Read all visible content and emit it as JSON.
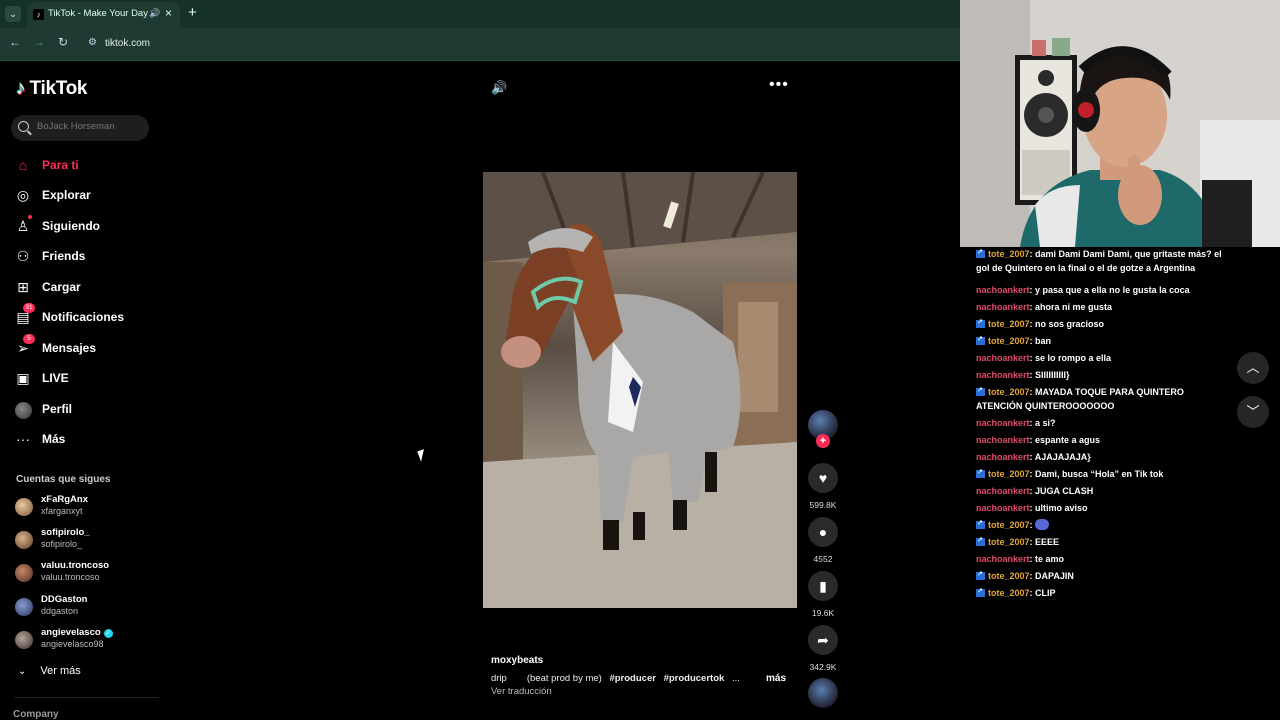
{
  "browser": {
    "tab_title": "TikTok - Make Your Day",
    "url": "tiktok.com"
  },
  "sidebar": {
    "logo_text": "TikTok",
    "search_placeholder": "BoJack Horseman",
    "menu": [
      {
        "label": "Para ti",
        "icon": "home-icon",
        "active": true
      },
      {
        "label": "Explorar",
        "icon": "compass-icon"
      },
      {
        "label": "Siguiendo",
        "icon": "following-icon"
      },
      {
        "label": "Friends",
        "icon": "friends-icon"
      },
      {
        "label": "Cargar",
        "icon": "upload-icon"
      },
      {
        "label": "Notificaciones",
        "icon": "inbox-icon",
        "badge": "31"
      },
      {
        "label": "Mensajes",
        "icon": "send-icon",
        "badge": "5"
      },
      {
        "label": "LIVE",
        "icon": "live-icon"
      },
      {
        "label": "Perfil",
        "icon": "avatar"
      },
      {
        "label": "Más",
        "icon": "more-icon"
      }
    ],
    "following_title": "Cuentas que sigues",
    "accounts": [
      {
        "name": "xFaRgAnx",
        "handle": "xfarganxyt"
      },
      {
        "name": "sofipirolo_",
        "handle": "sofipirolo_"
      },
      {
        "name": "valuu.troncoso",
        "handle": "valuu.troncoso"
      },
      {
        "name": "DDGaston",
        "handle": "ddgaston"
      },
      {
        "name": "angievelasco",
        "handle": "angievelasco98",
        "verified": true
      }
    ],
    "see_more": "Ver más",
    "company": "Company"
  },
  "video": {
    "author": "moxybeats",
    "desc_start": "drip",
    "desc_paren": "(beat prod by me)",
    "tags": [
      "#producer",
      "#producertok"
    ],
    "ellipsis": "...",
    "more": "más",
    "translate": "Ver traducción",
    "likes": "599.8K",
    "comments": "4552",
    "saves": "19.6K",
    "shares": "342.9K"
  },
  "colors": {
    "accent": "#fe2c55",
    "chat_user_tote": "#e0a73a",
    "chat_user_nacho": "#e04a6a",
    "chrome_bg": "#1f3a33"
  },
  "chat": [
    {
      "user": "tote_2007",
      "type": "tote",
      "text": ": dami Dami Dami Dami, que gritaste más? el gol de Quintero en la final o el de gotze a Argentina"
    },
    {
      "user": "nachoankert",
      "type": "nacho",
      "text": ": y pasa que a ella no le gusta la coca"
    },
    {
      "user": "nachoankert",
      "type": "nacho",
      "text": ": ahora ni me gusta"
    },
    {
      "user": "tote_2007",
      "type": "tote",
      "text": ": no sos gracioso"
    },
    {
      "user": "tote_2007",
      "type": "tote",
      "text": ": ban"
    },
    {
      "user": "nachoankert",
      "type": "nacho",
      "text": ": se lo rompo a ella"
    },
    {
      "user": "nachoankert",
      "type": "nacho",
      "text": ": SIIIIIIIIII}"
    },
    {
      "user": "tote_2007",
      "type": "tote",
      "text": ": MAYADA TOQUE PARA QUINTERO ATENCIÓN QUINTEROOOOOOO"
    },
    {
      "user": "nachoankert",
      "type": "nacho",
      "text": ": a si?"
    },
    {
      "user": "nachoankert",
      "type": "nacho",
      "text": ": espante a agus"
    },
    {
      "user": "nachoankert",
      "type": "nacho",
      "text": ": AJAJAJAJA}"
    },
    {
      "user": "tote_2007",
      "type": "tote",
      "text": ": Dami, busca “Hola” en Tik tok"
    },
    {
      "user": "nachoankert",
      "type": "nacho",
      "text": ": JUGA CLASH"
    },
    {
      "user": "nachoankert",
      "type": "nacho",
      "text": ": ultimo aviso"
    },
    {
      "user": "tote_2007",
      "type": "tote",
      "text": ": ",
      "emote": true
    },
    {
      "user": "tote_2007",
      "type": "tote",
      "text": ": EEEE"
    },
    {
      "user": "nachoankert",
      "type": "nacho",
      "text": ": te amo"
    },
    {
      "user": "tote_2007",
      "type": "tote",
      "text": ": DAPAJIN"
    },
    {
      "user": "tote_2007",
      "type": "tote",
      "text": ": CLIP"
    }
  ]
}
